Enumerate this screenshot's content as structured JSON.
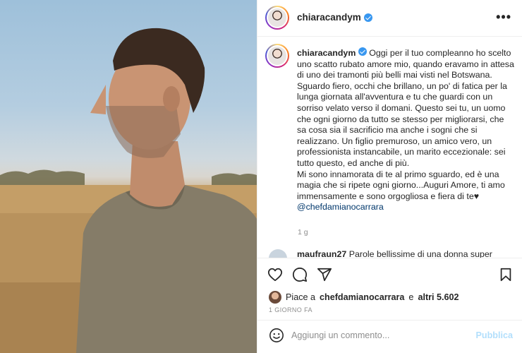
{
  "post": {
    "username": "chiaracandym",
    "more_icon": "more-horizontal-icon"
  },
  "caption": {
    "username": "chiaracandym",
    "lines": [
      "Oggi per il tuo compleanno ho scelto uno scatto rubato amore mio, quando eravamo in attesa di uno dei tramonti più belli mai visti nel Botswana. Sguardo fiero, occhi che brillano, un po' di fatica per la lunga giornata all'avventura e tu che guardi con un sorriso velato verso il domani. Questo sei tu, un uomo che ogni giorno da tutto se stesso per migliorarsi, che sa cosa sia il sacrificio ma anche i sogni che si realizzano. Un figlio premuroso, un amico vero, un professionista instancabile, un marito eccezionale: sei tutto questo, ed anche di più.",
      "Mi sono innamorata di te al primo sguardo, ed è una magia che si ripete ogni giorno...Auguri Amore, ti amo immensamente e sono orgogliosa e fiera di te"
    ],
    "heart": "♥",
    "mention": "@chefdamianocarrara",
    "time": "1 g"
  },
  "next_comment": {
    "username": "maufraun27",
    "text": "Parole bellissime di una donna super"
  },
  "actions": {
    "like_icon": "heart-icon",
    "comment_icon": "comment-icon",
    "share_icon": "share-icon",
    "save_icon": "bookmark-icon"
  },
  "likes": {
    "prefix": "Piace a",
    "user": "chefdamianocarrara",
    "connector": "e",
    "others": "altri 5.602"
  },
  "date": "1 GIORNO FA",
  "comment_box": {
    "placeholder": "Aggiungi un commento...",
    "publish_label": "Pubblica",
    "emoji_icon": "emoji-icon"
  },
  "colors": {
    "link": "#00376b",
    "verified": "#3897f0",
    "publish_disabled": "#b2dffc",
    "muted": "#8e8e8e"
  }
}
